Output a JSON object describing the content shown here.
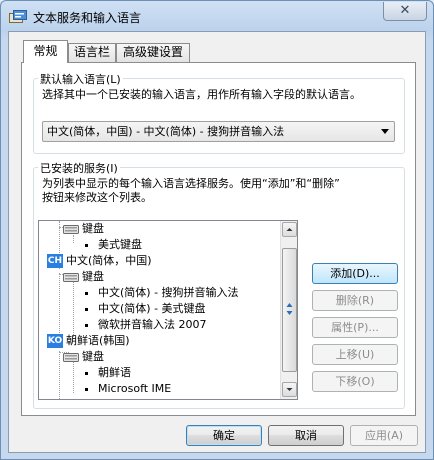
{
  "window": {
    "title": "文本服务和输入语言",
    "close_glyph": "✕"
  },
  "tabs": [
    {
      "label": "常规",
      "active": true
    },
    {
      "label": "语言栏",
      "active": false
    },
    {
      "label": "高级键设置",
      "active": false
    }
  ],
  "default_language": {
    "legend": "默认输入语言(L)",
    "description": "选择其中一个已安装的输入语言，用作所有输入字段的默认语言。",
    "selected": "中文(简体，中国) - 中文(简体) - 搜狗拼音输入法"
  },
  "installed_services": {
    "legend": "已安装的服务(I)",
    "description_line1": "为列表中显示的每个输入语言选择服务。使用“添加”和“删除”",
    "description_line2": "按钮来修改这个列表。",
    "tree": [
      {
        "level": 1,
        "text": "键盘",
        "icon": "keyboard-icon"
      },
      {
        "level": 2,
        "text": "美式键盘",
        "icon": "bullet"
      },
      {
        "level": 0,
        "text": "中文(简体，中国)",
        "badge": "CH"
      },
      {
        "level": 1,
        "text": "键盘",
        "icon": "keyboard-icon"
      },
      {
        "level": 2,
        "text": "中文(简体) - 搜狗拼音输入法",
        "icon": "bullet"
      },
      {
        "level": 2,
        "text": "中文(简体) - 美式键盘",
        "icon": "bullet"
      },
      {
        "level": 2,
        "text": "微软拼音输入法 2007",
        "icon": "bullet"
      },
      {
        "level": 0,
        "text": "朝鲜语(韩国)",
        "badge": "KO"
      },
      {
        "level": 1,
        "text": "键盘",
        "icon": "keyboard-icon"
      },
      {
        "level": 2,
        "text": "朝鲜语",
        "icon": "bullet"
      },
      {
        "level": 2,
        "text": "Microsoft IME",
        "icon": "bullet"
      }
    ],
    "buttons": {
      "add": "添加(D)...",
      "remove": "删除(R)",
      "properties": "属性(P)...",
      "move_up": "上移(U)",
      "move_down": "下移(O)"
    }
  },
  "footer": {
    "ok": "确定",
    "cancel": "取消",
    "apply": "应用(A)"
  },
  "colors": {
    "language_badge": "#2a7fe0",
    "title_bar": "#bcd2ec"
  }
}
